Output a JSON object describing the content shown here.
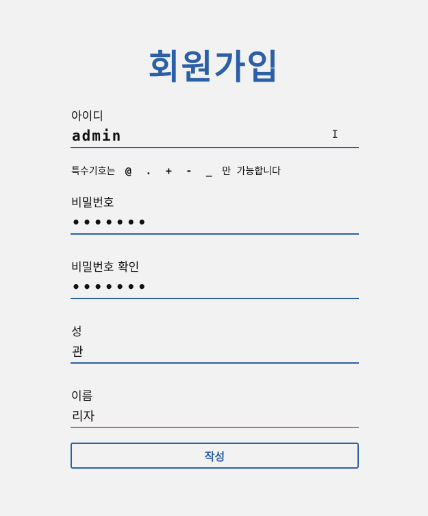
{
  "page": {
    "title": "회원가입"
  },
  "form": {
    "username": {
      "label": "아이디",
      "value": "admin"
    },
    "hint": {
      "prefix": "특수기호는",
      "symbols": [
        "@",
        ".",
        "+",
        "-",
        "_"
      ],
      "suffix": "만 가능합니다"
    },
    "password": {
      "label": "비밀번호",
      "value": "•••••••"
    },
    "password_confirm": {
      "label": "비밀번호 확인",
      "value": "•••••••"
    },
    "last_name": {
      "label": "성",
      "value": "관"
    },
    "first_name": {
      "label": "이름",
      "value": "리자"
    },
    "submit_label": "작성"
  },
  "colors": {
    "accent": "#2b5fa8",
    "active_underline": "#c0744a",
    "background": "#f2f2f2"
  },
  "icons": {
    "text_cursor": "i-beam-cursor-icon"
  }
}
